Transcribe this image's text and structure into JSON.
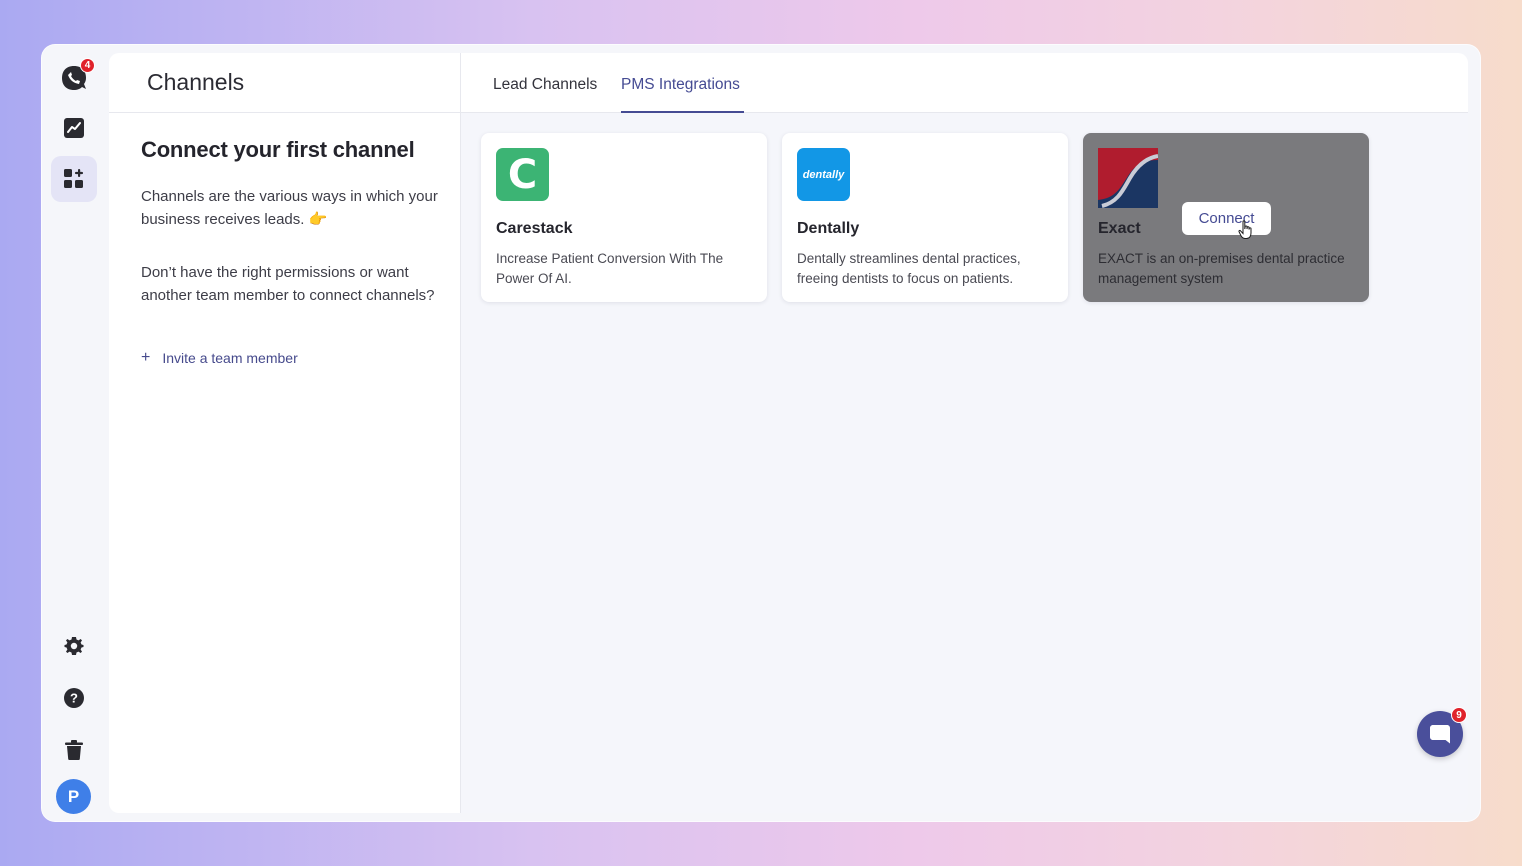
{
  "app": {
    "notification_count": "4",
    "avatar_initial": "P"
  },
  "rail": {
    "items": [
      {
        "name": "analytics-icon"
      },
      {
        "name": "channels-icon",
        "active": true
      },
      {
        "name": "settings-icon"
      },
      {
        "name": "help-icon"
      },
      {
        "name": "trash-icon"
      }
    ]
  },
  "left": {
    "page_title": "Channels",
    "connect_title": "Connect your first channel",
    "intro": "Channels are the various ways in which your business receives leads. 👉",
    "permissions": "Don’t have the right permissions or want another team member to connect channels?",
    "invite_plus": "+",
    "invite_label": "Invite a team member"
  },
  "tabs": [
    {
      "label": "Lead Channels",
      "active": false
    },
    {
      "label": "PMS Integrations",
      "active": true
    }
  ],
  "integrations": [
    {
      "name": "Carestack",
      "description": "Increase Patient Conversion With The Power Of AI.",
      "logo_text": "C",
      "logo_color": "#3cb474"
    },
    {
      "name": "Dentally",
      "description": "Dentally streamlines dental practices, freeing dentists to focus on patients.",
      "logo_text": "dentally",
      "logo_color": "#1297e6"
    },
    {
      "name": "Exact",
      "description": "EXACT is an on-premises dental practice management system",
      "connect_label": "Connect",
      "logo_colors": [
        "#b01c2e",
        "#1b3663"
      ]
    }
  ],
  "chat": {
    "unread_count": "9"
  },
  "colors": {
    "accent": "#454b93",
    "badge": "#e0222b",
    "avatar": "#3f7fe8"
  }
}
